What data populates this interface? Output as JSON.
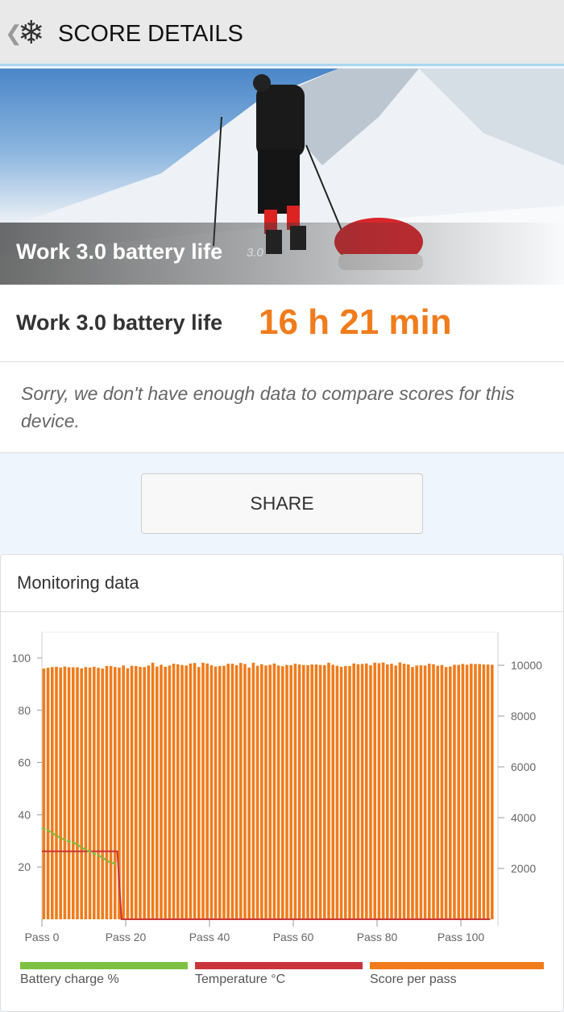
{
  "header": {
    "title": "SCORE DETAILS",
    "back_icon": "chevron-left-icon",
    "logo_icon": "snowflake-icon"
  },
  "hero": {
    "title": "Work 3.0 battery life",
    "version": "3.0"
  },
  "result": {
    "label": "Work 3.0 battery life",
    "value": "16 h 21 min",
    "value_color": "#f07c1c",
    "message": "Sorry, we don't have enough data to compare scores for this device."
  },
  "share_label": "SHARE",
  "monitoring": {
    "title": "Monitoring data"
  },
  "chart_data": {
    "type": "bar",
    "x_tick_labels": [
      "Pass 0",
      "Pass 20",
      "Pass 40",
      "Pass 60",
      "Pass 80",
      "Pass 100"
    ],
    "x_ticks": [
      0,
      20,
      40,
      60,
      80,
      100
    ],
    "left_axis": {
      "ticks": [
        20,
        40,
        60,
        80,
        100
      ],
      "range": [
        0,
        100
      ]
    },
    "right_axis": {
      "ticks": [
        2000,
        4000,
        6000,
        8000,
        10000
      ],
      "range": [
        0,
        10000
      ]
    },
    "series": [
      {
        "name": "Battery charge %",
        "type": "line",
        "axis": "left",
        "color": "#7dc142",
        "x": [
          0,
          2,
          4,
          6,
          8,
          10,
          12,
          14,
          16,
          18
        ],
        "values": [
          35,
          33.5,
          31.5,
          30,
          29,
          27,
          25.5,
          24,
          22,
          21
        ]
      },
      {
        "name": "Temperature °C",
        "type": "line",
        "axis": "left",
        "color": "#c9353a",
        "x": [
          0,
          18,
          19,
          107
        ],
        "values": [
          26,
          26,
          0,
          0
        ]
      },
      {
        "name": "Score per pass",
        "type": "bar",
        "axis": "right",
        "color": "#f07c1c",
        "values": [
          9870,
          9900,
          9930,
          9940,
          9910,
          9950,
          9920,
          9920,
          9920,
          9880,
          9930,
          9910,
          9940,
          9900,
          9870,
          9970,
          9970,
          9930,
          9910,
          9990,
          9880,
          9980,
          9970,
          9940,
          9930,
          9990,
          10100,
          9950,
          10020,
          9940,
          9990,
          10060,
          10040,
          10010,
          9990,
          10070,
          10090,
          9930,
          10100,
          10070,
          10000,
          9950,
          9970,
          9980,
          10060,
          10060,
          10000,
          10090,
          10050,
          9910,
          10100,
          9980,
          10040,
          9990,
          10020,
          10070,
          9990,
          9960,
          10010,
          10000,
          10060,
          10030,
          10010,
          10000,
          10030,
          10030,
          10010,
          10000,
          10100,
          10020,
          9980,
          9940,
          9970,
          9970,
          10070,
          10040,
          10050,
          10070,
          10000,
          10100,
          10080,
          10110,
          10030,
          10060,
          9990,
          10110,
          10060,
          10030,
          9930,
          9990,
          10000,
          9990,
          10060,
          10040,
          9980,
          10010,
          9930,
          9950,
          10020,
          10010,
          10050,
          10020,
          10060,
          10050,
          10050,
          10030,
          10030,
          10020
        ]
      }
    ],
    "legend": "bottom"
  }
}
